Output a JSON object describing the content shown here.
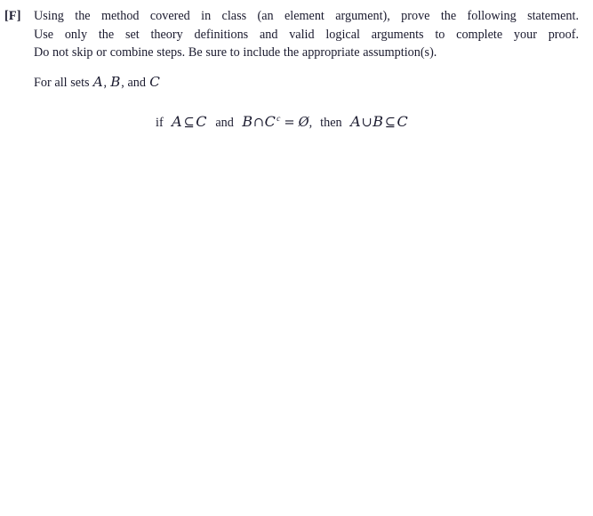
{
  "document": {
    "background_color": "#ffffff",
    "text_color": "#1a1a2e"
  },
  "problem": {
    "label": "[F]",
    "instructions": {
      "line1": "Using the method covered in class (an element argument), prove the following statement.",
      "line2": "Use only the set theory definitions and valid logical arguments to complete your proof.",
      "line3": "Do not skip or combine steps.  Be sure to include the appropriate assumption(s)."
    },
    "quantifier_sentence": {
      "prefix": "For all sets ",
      "set_a": "A",
      "sep1": ", ",
      "set_b": "B",
      "sep2": ", and ",
      "set_c": "C"
    },
    "statement": {
      "if_word": "if",
      "hyp1_left": "A",
      "hyp1_relation": "⊆",
      "hyp1_right": "C",
      "connective": "and",
      "hyp2_left": "B",
      "hyp2_operator": "∩",
      "hyp2_right": "C",
      "hyp2_superscript": "c",
      "hyp2_equals": "=",
      "hyp2_value": "Ø",
      "comma": ",",
      "then_word": "then",
      "concl_left": "A",
      "concl_operator": "∪",
      "concl_middle": "B",
      "concl_relation": "⊆",
      "concl_right": "C"
    }
  }
}
